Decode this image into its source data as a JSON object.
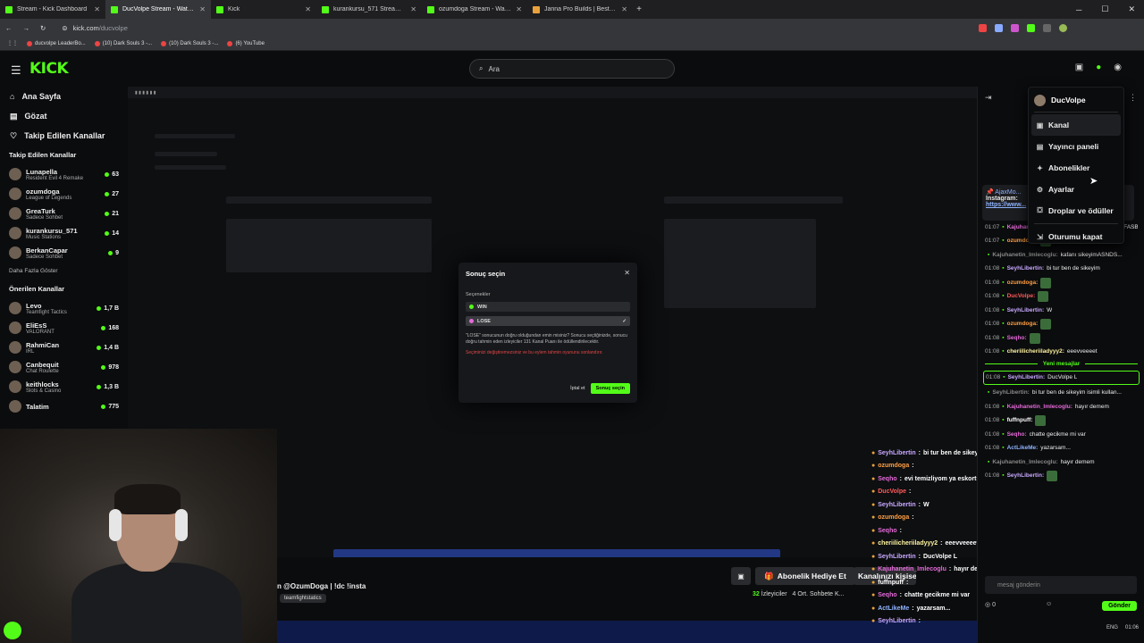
{
  "browser": {
    "tabs": [
      {
        "title": "Stream - Kick Dashboard",
        "active": false,
        "favicon": "kick"
      },
      {
        "title": "DucVolpe Stream - Watch Live",
        "active": true,
        "favicon": "kick"
      },
      {
        "title": "Kick",
        "active": false,
        "favicon": "kick"
      },
      {
        "title": "kurankursu_571 Stream - Watch",
        "active": false,
        "favicon": "kick"
      },
      {
        "title": "ozumdoga Stream - Watch",
        "active": false,
        "favicon": "kick"
      },
      {
        "title": "Janna Pro Builds | Best New Pr...",
        "active": false,
        "favicon": "orange"
      }
    ],
    "url_host": "kick.com",
    "url_path": "/ducvolpe",
    "bookmarks": [
      "ducvolpe LeaderBo...",
      "(10) Dark Souls 3 -...",
      "(10) Dark Souls 3 -...",
      "(6) YouTube"
    ]
  },
  "header": {
    "logo": "KICK",
    "search_placeholder": "Ara"
  },
  "sidebar": {
    "nav": [
      {
        "label": "Ana Sayfa",
        "icon": "home-icon"
      },
      {
        "label": "Gözat",
        "icon": "browse-icon"
      },
      {
        "label": "Takip Edilen Kanallar",
        "icon": "heart-icon"
      }
    ],
    "followed_title": "Takip Edilen Kanallar",
    "followed": [
      {
        "name": "Lunapella",
        "game": "Resident Evil 4 Remake",
        "count": "63"
      },
      {
        "name": "ozumdoga",
        "game": "League of Legends",
        "count": "27"
      },
      {
        "name": "GreaTurk",
        "game": "Sadece Sohbet",
        "count": "21"
      },
      {
        "name": "kurankursu_571",
        "game": "Music Stations",
        "count": "14"
      },
      {
        "name": "BerkanCapar",
        "game": "Sadece Sohbet",
        "count": "9"
      }
    ],
    "more_label": "Daha Fazla Göster",
    "recommended_title": "Önerilen Kanallar",
    "recommended": [
      {
        "name": "Levo",
        "game": "Teamfight Tactics",
        "count": "1,7 B"
      },
      {
        "name": "EliEsS",
        "game": "VALORANT",
        "count": "168"
      },
      {
        "name": "RahmiCan",
        "game": "IRL",
        "count": "1,4 B"
      },
      {
        "name": "Canbequit",
        "game": "Chat Roulette",
        "count": "978"
      },
      {
        "name": "keithlocks",
        "game": "Slots & Casino",
        "count": "1,3 B"
      },
      {
        "name": "Talatim",
        "game": "",
        "count": "775"
      }
    ]
  },
  "dialog": {
    "title": "Sonuç seçin",
    "options_label": "Seçenekler",
    "option_win": "WIN",
    "option_lose": "LOSE",
    "note": "\"LOSE\" sonucunun doğru olduğundan emin misiniz? Sonucu seçtiğinizde, sonucu doğru tahmin eden izleyiciler 131 Kanal Puanı ile ödüllendirilecektir.",
    "warning": "Seçiminizi değiştiremezsiniz ve bu eylem tahmin oyununu sonlandırır.",
    "cancel": "İptal et",
    "confirm": "Sonuç seçin"
  },
  "stream": {
    "title": "n @OzumDoga | !dc !insta",
    "tag": "teamfightstatics",
    "subscribe_label": "Abonelik Hediye Et",
    "customize_label": "Kanalınızı kişiselleştirin",
    "viewers": "32",
    "viewers_label": "İzleyiciler",
    "avg_label": "4 Ort. Sohbete K..."
  },
  "overlay_chat": [
    {
      "user": "SeyhLibertin",
      "msg": "bi tur ben de sikeyim",
      "color": "#c8a8ff"
    },
    {
      "user": "ozumdoga",
      "msg": "",
      "color": "#ff9f43"
    },
    {
      "user": "Seqho",
      "msg": "evi temizliyom ya eskortum",
      "color": "#e46ad8"
    },
    {
      "user": "DucVolpe",
      "msg": "",
      "color": "#ff5a5a"
    },
    {
      "user": "SeyhLibertin",
      "msg": "W",
      "color": "#c8a8ff"
    },
    {
      "user": "ozumdoga",
      "msg": "",
      "color": "#ff9f43"
    },
    {
      "user": "Seqho",
      "msg": "",
      "color": "#e46ad8"
    },
    {
      "user": "cheriilicheriiladyyy2",
      "msg": "eeevveeeet",
      "color": "#fff3a0"
    },
    {
      "user": "SeyhLibertin",
      "msg": "DucVolpe L",
      "color": "#c8a8ff"
    },
    {
      "user": "Kajuhanetin_Imlecoglu",
      "msg": "hayır demem",
      "color": "#e46ad8"
    },
    {
      "user": "fuffnpuff",
      "msg": "",
      "color": "#ffffff"
    },
    {
      "user": "Seqho",
      "msg": "chatte gecikme mi var",
      "color": "#e46ad8"
    },
    {
      "user": "ActLikeMe",
      "msg": "yazarsam...",
      "color": "#8fb4ff"
    },
    {
      "user": "SeyhLibertin",
      "msg": "",
      "color": "#c8a8ff"
    }
  ],
  "chat": {
    "pinned_user": "AjaxMo...",
    "pinned_text": "Instagram:",
    "pinned_link": "https://www...",
    "messages": [
      {
        "time": "01:07",
        "user": "Kajuhanetin_Imlecoglu:",
        "msg": "sikeyimASNDSDMFASBDASJDFASMFDASPFAPSFDASĞDFASDKFASGDFASDĞD",
        "color": "#e46ad8"
      },
      {
        "time": "01:07",
        "user": "ozumdoga:",
        "msg": "",
        "color": "#ff9f43",
        "emote": true
      },
      {
        "time": "",
        "user": "Kajuhanetin_Imlecoglu:",
        "msg": "kafanı sikeyimASNDS...",
        "color": "#888"
      },
      {
        "time": "01:08",
        "user": "SeyhLibertin:",
        "msg": "bi tur ben de sikeyim",
        "color": "#c8a8ff"
      },
      {
        "time": "01:08",
        "user": "ozumdoga:",
        "msg": "",
        "color": "#ff9f43",
        "emote": true
      },
      {
        "time": "01:08",
        "user": "DucVolpe:",
        "msg": "",
        "color": "#ff5a5a",
        "emote": true
      },
      {
        "time": "01:08",
        "user": "SeyhLibertin:",
        "msg": "W",
        "color": "#c8a8ff"
      },
      {
        "time": "01:08",
        "user": "ozumdoga:",
        "msg": "",
        "color": "#ff9f43",
        "emote": true
      },
      {
        "time": "01:08",
        "user": "Seqho:",
        "msg": "",
        "color": "#e46ad8",
        "emote": true
      },
      {
        "time": "01:08",
        "user": "cheriilicheriiladyyy2:",
        "msg": "eeevveeeet",
        "color": "#fff3a0"
      }
    ],
    "new_messages": "Yeni mesajlar",
    "highlight": {
      "time": "01:08",
      "user": "SeyhLibertin:",
      "msg": "DucVolpe L",
      "color": "#c8a8ff"
    },
    "messages2": [
      {
        "time": "",
        "user": "SeyhLibertin:",
        "msg": "bi tur ben de sikeyim isimli kullan...",
        "color": "#888"
      },
      {
        "time": "01:08",
        "user": "Kajuhanetin_Imlecoglu:",
        "msg": "hayır demem",
        "color": "#e46ad8"
      },
      {
        "time": "01:08",
        "user": "fuffnpuff:",
        "msg": "",
        "color": "#ffffff",
        "emote": true
      },
      {
        "time": "01:08",
        "user": "Seqho:",
        "msg": "chatte gecikme mi var",
        "color": "#e46ad8"
      },
      {
        "time": "01:08",
        "user": "ActLikeMe:",
        "msg": "yazarsam...",
        "color": "#8fb4ff"
      },
      {
        "time": "",
        "user": "Kajuhanetin_Imlecoglu:",
        "msg": "hayır demem",
        "color": "#888"
      },
      {
        "time": "01:08",
        "user": "SeyhLibertin:",
        "msg": "",
        "color": "#c8a8ff",
        "emote": true
      }
    ],
    "input_placeholder": "mesaj gönderin",
    "points": "0",
    "send": "Gönder"
  },
  "dropdown": {
    "username": "DucVolpe",
    "items": [
      {
        "label": "Kanal",
        "icon": "channel-icon",
        "hover": true
      },
      {
        "label": "Yayıncı paneli",
        "icon": "dashboard-icon",
        "hover": false
      },
      {
        "label": "Abonelikler",
        "icon": "star-icon",
        "hover": false
      },
      {
        "label": "Ayarlar",
        "icon": "gear-icon",
        "hover": false
      },
      {
        "label": "Droplar ve ödüller",
        "icon": "gift-icon",
        "hover": false
      },
      {
        "label": "Oturumu kapat",
        "icon": "logout-icon",
        "hover": false
      }
    ]
  },
  "taskbar": {
    "lang": "ENG",
    "time": "01:06"
  }
}
